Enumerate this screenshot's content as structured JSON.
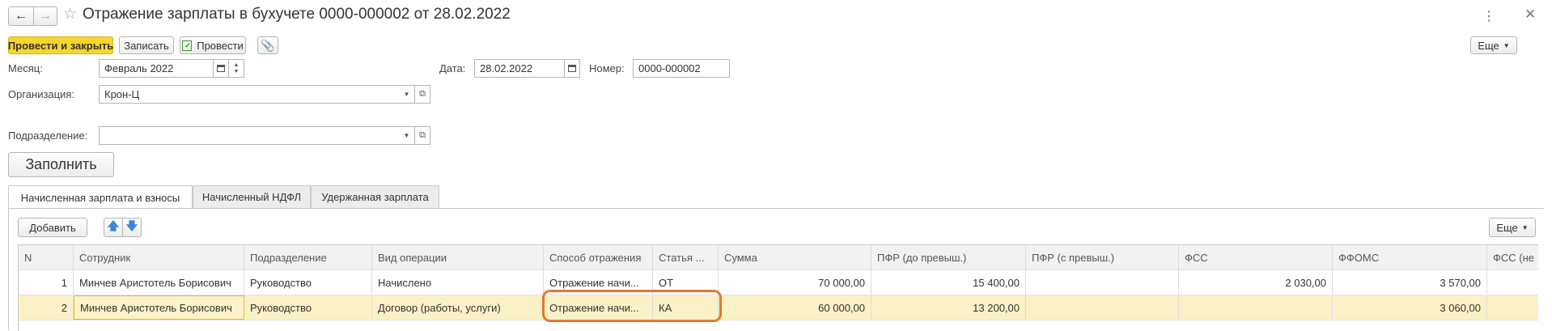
{
  "window": {
    "title": "Отражение зарплаты в бухучете 0000-000002 от 28.02.2022"
  },
  "toolbar": {
    "post_close": "Провести и закрыть",
    "save": "Записать",
    "post": "Провести",
    "more": "Еще"
  },
  "form": {
    "month_label": "Месяц:",
    "month_value": "Февраль 2022",
    "date_label": "Дата:",
    "date_value": "28.02.2022",
    "number_label": "Номер:",
    "number_value": "0000-000002",
    "org_label": "Организация:",
    "org_value": "Крон-Ц",
    "dept_label": "Подразделение:",
    "dept_value": "",
    "fill_button": "Заполнить"
  },
  "tabs": [
    {
      "label": "Начисленная зарплата и взносы",
      "active": true
    },
    {
      "label": "Начисленный НДФЛ",
      "active": false
    },
    {
      "label": "Удержанная зарплата",
      "active": false
    }
  ],
  "table_toolbar": {
    "add": "Добавить",
    "more": "Еще"
  },
  "table": {
    "columns": [
      "N",
      "Сотрудник",
      "Подразделение",
      "Вид операции",
      "Способ отражения",
      "Статья ...",
      "Сумма",
      "ПФР (до превыш.)",
      "ПФР (с превыш.)",
      "ФСС",
      "ФФОМС",
      "ФСС (не"
    ],
    "rows": [
      [
        "1",
        "Минчев Аристотель Борисович",
        "Руководство",
        "Начислено",
        "Отражение начи...",
        "ОТ",
        "70 000,00",
        "15 400,00",
        "",
        "2 030,00",
        "3 570,00",
        ""
      ],
      [
        "2",
        "Минчев Аристотель Борисович",
        "Руководство",
        "Договор (работы, услуги)",
        "Отражение начи...",
        "КА",
        "60 000,00",
        "13 200,00",
        "",
        "",
        "3 060,00",
        ""
      ]
    ]
  },
  "colors": {
    "accent_yellow": "#f7d52c",
    "selected_row": "#fbf1c6",
    "highlight_ring": "#e8772e",
    "arrow_blue": "#3b87d8"
  }
}
